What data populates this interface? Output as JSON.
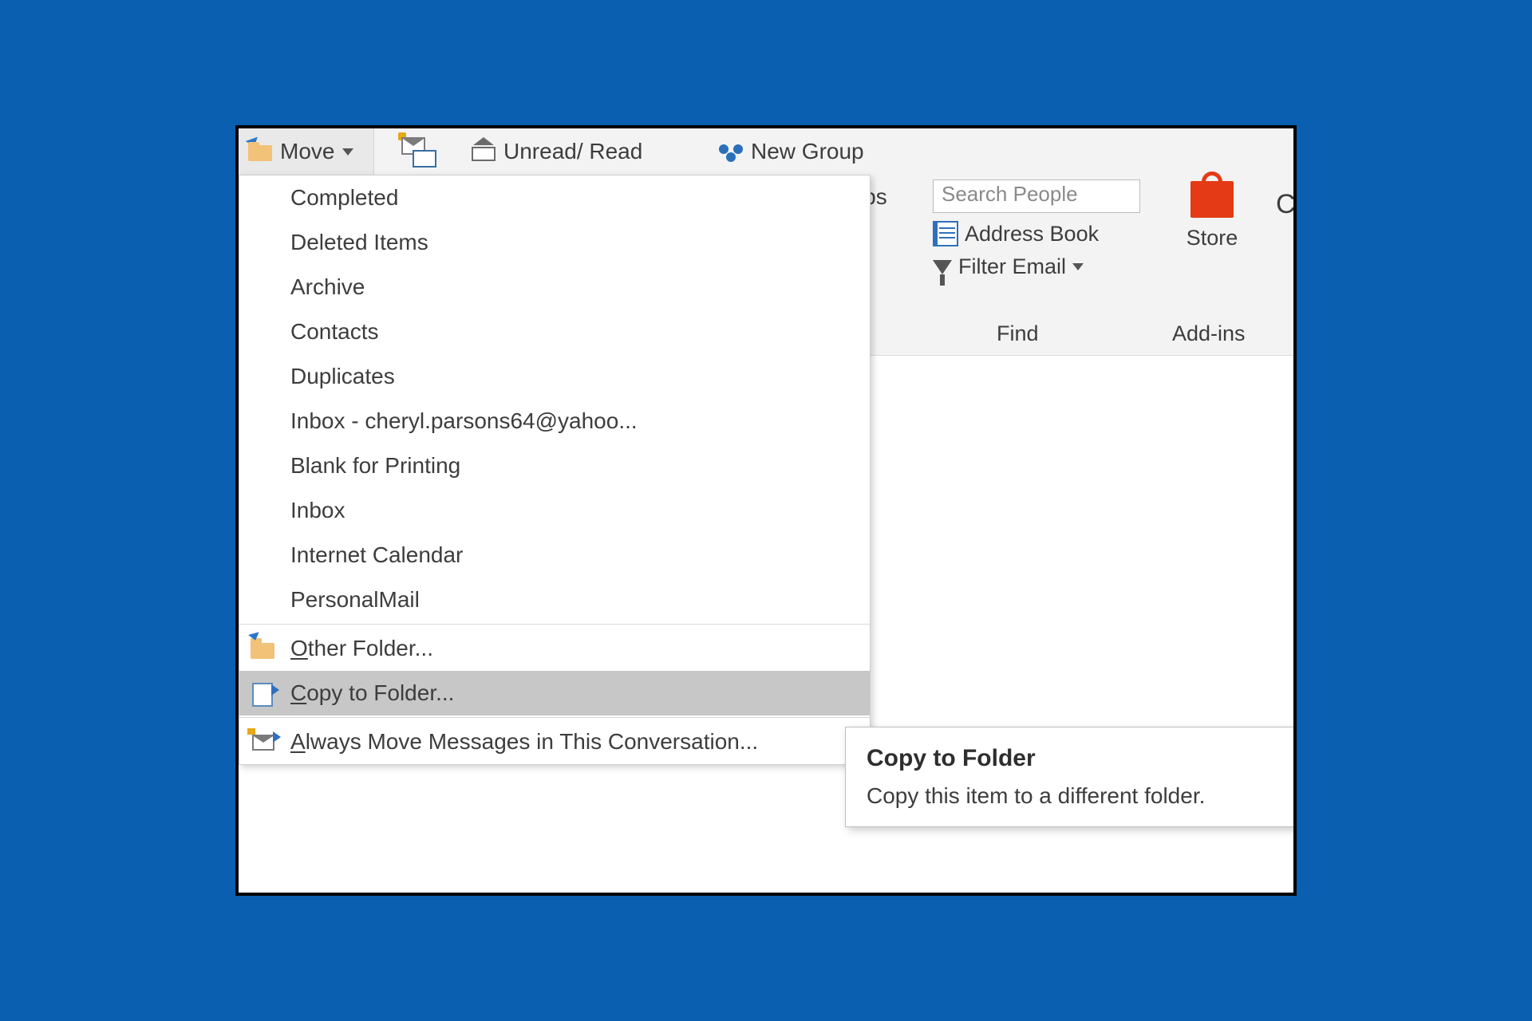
{
  "ribbon": {
    "move_label": "Move",
    "unread_label": "Unread/ Read",
    "new_group_label": "New Group",
    "groups_fragment": "oups",
    "c_fragment": "C"
  },
  "find": {
    "search_placeholder": "Search People",
    "address_book_label": "Address Book",
    "filter_email_label": "Filter Email",
    "group_label": "Find"
  },
  "addins": {
    "store_label": "Store",
    "group_label": "Add-ins"
  },
  "dropdown": {
    "folders": [
      "Completed",
      "Deleted Items",
      "Archive",
      "Contacts",
      "Duplicates",
      "Inbox - cheryl.parsons64@yahoo...",
      "Blank for Printing",
      "Inbox",
      "Internet Calendar",
      "PersonalMail"
    ],
    "other_folder_prefix": "O",
    "other_folder_rest": "ther Folder...",
    "copy_prefix": "C",
    "copy_rest": "opy to Folder...",
    "always_prefix": "A",
    "always_rest": "lways Move Messages in This Conversation..."
  },
  "tooltip": {
    "title": "Copy to Folder",
    "description": "Copy this item to a different folder."
  }
}
